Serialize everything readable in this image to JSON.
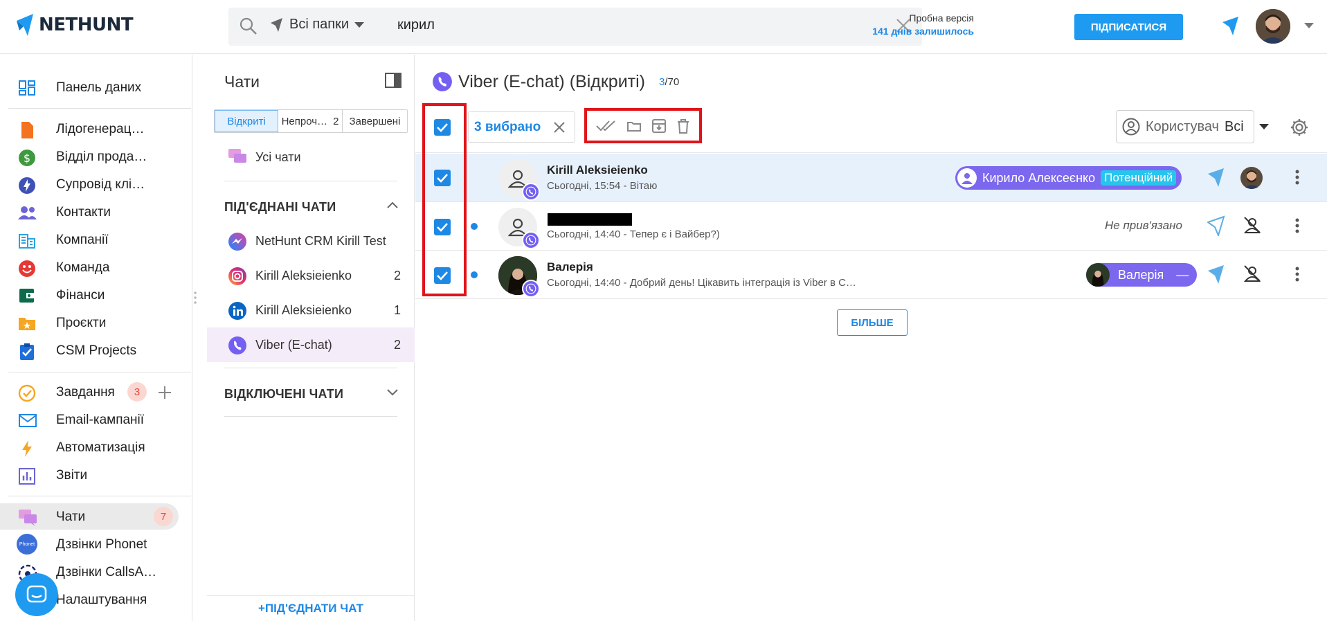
{
  "header": {
    "logo_text": "NETHUNT",
    "search_folder": "Всі папки",
    "search_query": "кирил",
    "trial_line1": "Пробна версія",
    "trial_line2": "141 днів залишилось",
    "subscribe_label": "ПІДПИСАТИСЯ"
  },
  "nav": {
    "items": [
      {
        "label": "Панель даних",
        "icon": "dashboard-icon"
      },
      {
        "label": "Лідогенерац…",
        "icon": "document-icon"
      },
      {
        "label": "Відділ прода…",
        "icon": "dollar-icon"
      },
      {
        "label": "Супровід клі…",
        "icon": "bolt-icon"
      },
      {
        "label": "Контакти",
        "icon": "people-icon"
      },
      {
        "label": "Компанії",
        "icon": "building-icon"
      },
      {
        "label": "Команда",
        "icon": "smiley-icon"
      },
      {
        "label": "Фінанси",
        "icon": "wallet-icon"
      },
      {
        "label": "Проєкти",
        "icon": "folder-star-icon"
      },
      {
        "label": "CSM Projects",
        "icon": "clipboard-check-icon"
      },
      {
        "label": "Завдання",
        "icon": "check-circle-icon",
        "badge": "3"
      },
      {
        "label": "Email-кампанії",
        "icon": "mail-icon"
      },
      {
        "label": "Автоматизація",
        "icon": "lightning-icon"
      },
      {
        "label": "Звіти",
        "icon": "bar-chart-icon"
      },
      {
        "label": "Чати",
        "icon": "chat-icon",
        "badge": "7"
      },
      {
        "label": "Дзвінки Phonet",
        "icon": "phonet-icon"
      },
      {
        "label": "Дзвінки CallsA…",
        "icon": "calls-icon"
      },
      {
        "label": "Налаштування",
        "icon": "settings-icon"
      }
    ],
    "phonet_text": "Phonet"
  },
  "chats_panel": {
    "title": "Чати",
    "tabs": [
      {
        "label": "Відкриті"
      },
      {
        "label": "Непроч…",
        "count": "2"
      },
      {
        "label": "Завершені"
      }
    ],
    "all_chats": "Усі чати",
    "connected_title": "ПІД'ЄДНАНІ ЧАТИ",
    "connected": [
      {
        "label": "NetHunt CRM Kirill Test",
        "count": ""
      },
      {
        "label": "Kirill Aleksieienko",
        "count": "2"
      },
      {
        "label": "Kirill Aleksieienko",
        "count": "1"
      },
      {
        "label": "Viber (E-chat)",
        "count": "2"
      }
    ],
    "disconnected_title": "ВІДКЛЮЧЕНІ ЧАТИ",
    "connect_button": "+ПІД'ЄДНАТИ ЧАТ"
  },
  "main": {
    "title": "Viber (E-chat) (Відкриті)",
    "count_current": "3",
    "count_total": "/70",
    "selected_label": "3 вибрано",
    "user_filter_label": "Користувач",
    "user_filter_value": "Всі",
    "more_button": "БІЛЬШЕ",
    "rows": [
      {
        "name": "Kirill Aleksieienko",
        "message": "Сьогодні, 15:54 - Вітаю",
        "contact": "Кирило Алексеєнко",
        "stage": "Потенційний"
      },
      {
        "name": "",
        "message": "Сьогодні, 14:40 - Тепер є і Вайбер?)",
        "status": "Не прив'язано"
      },
      {
        "name": "Валерія",
        "message": "Сьогодні, 14:40 - Добрий день! Цікавить інтеграція із Viber в С…",
        "contact": "Валерія",
        "contact_suffix": "—"
      }
    ]
  },
  "colors": {
    "accent": "#1e88e5",
    "viber": "#7360f2",
    "highlight_border": "#e0141a"
  }
}
